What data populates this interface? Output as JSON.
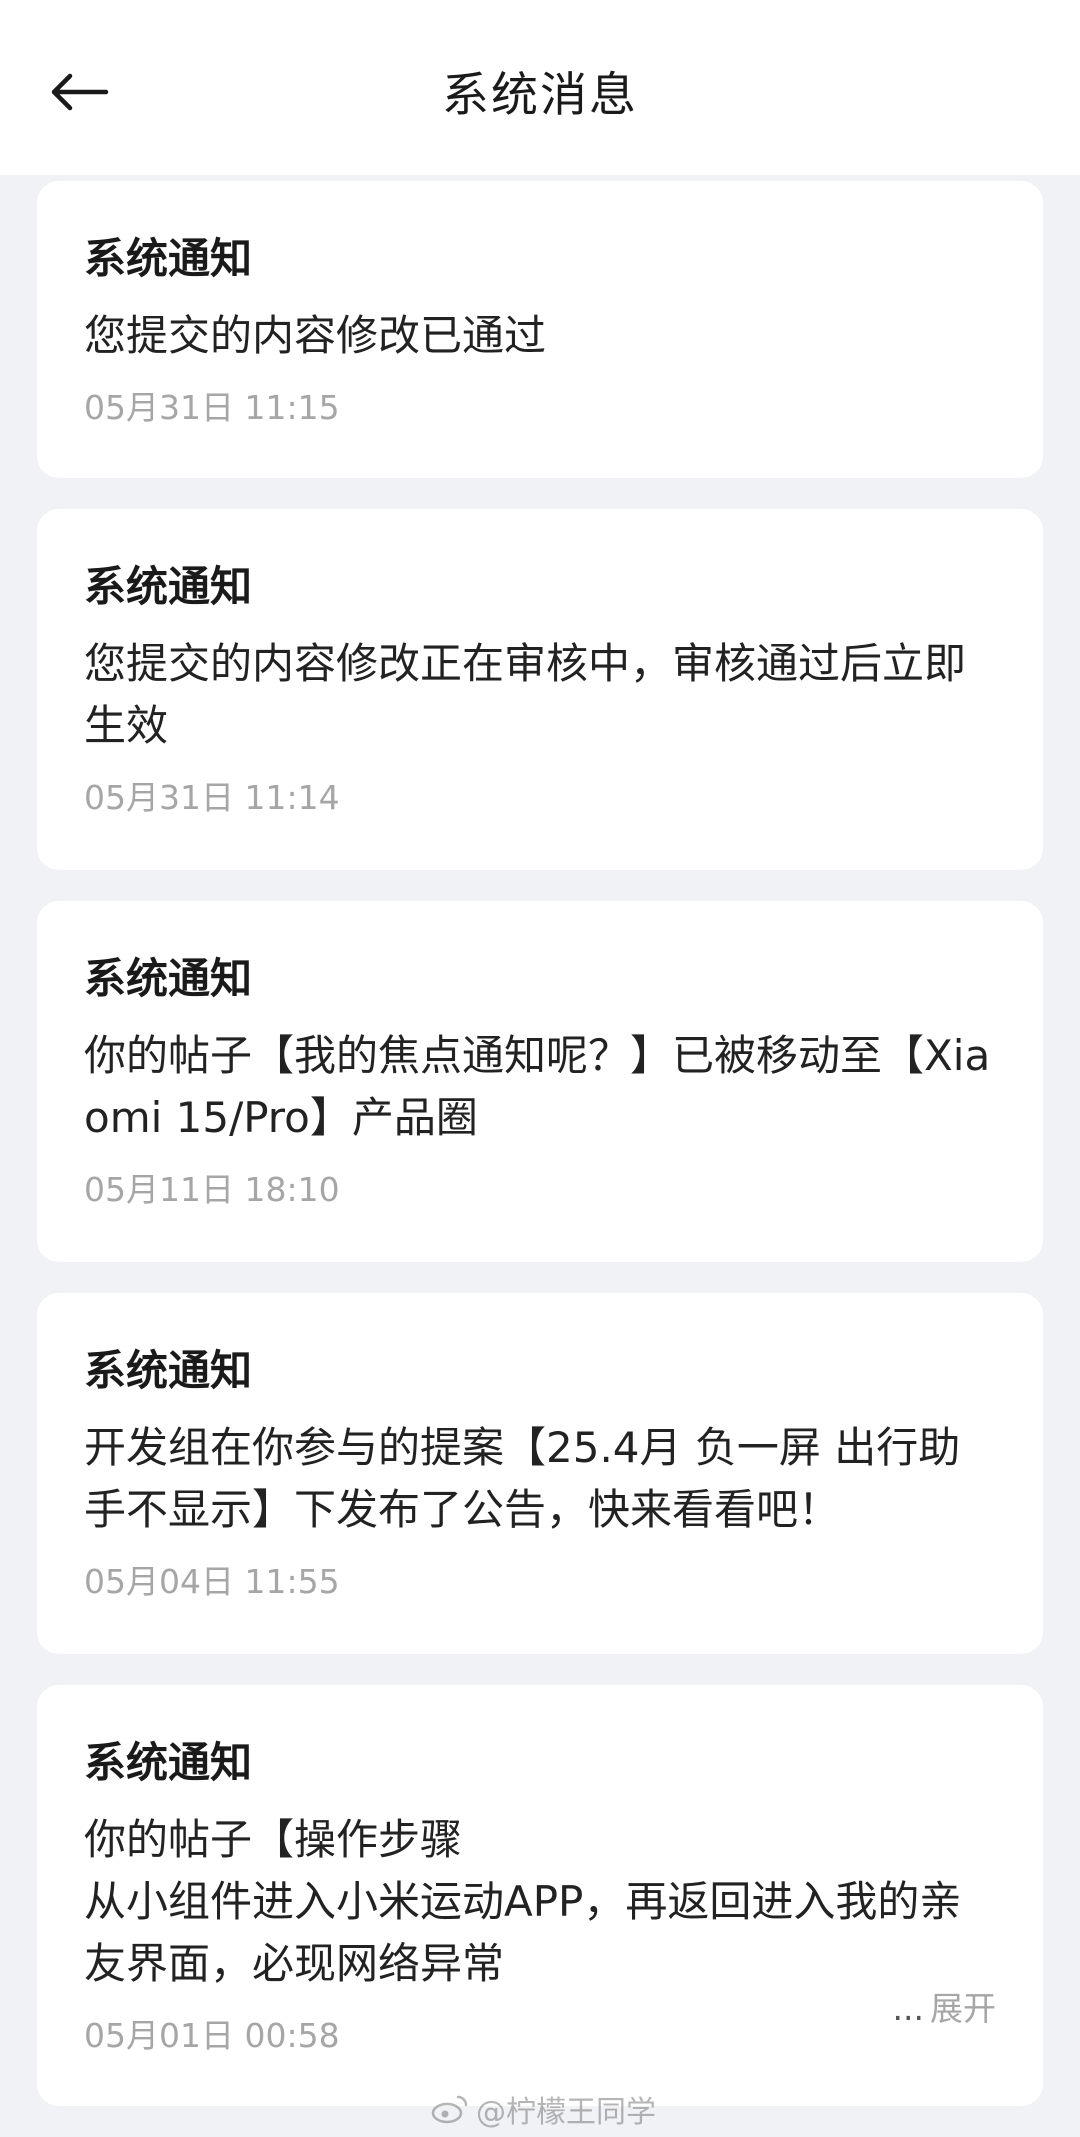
{
  "header": {
    "title": "系统消息",
    "back_icon": "arrow-left-icon"
  },
  "messages": [
    {
      "title": "系统通知",
      "body": "您提交的内容修改已通过",
      "time": "05月31日 11:15"
    },
    {
      "title": "系统通知",
      "body": "您提交的内容修改正在审核中，审核通过后立即生效",
      "time": "05月31日 11:14"
    },
    {
      "title": "系统通知",
      "body": "你的帖子【我的焦点通知呢？】已被移动至【Xiaomi 15/Pro】产品圈",
      "time": "05月11日 18:10"
    },
    {
      "title": "系统通知",
      "body": "开发组在你参与的提案【25.4月 负一屏 出行助手不显示】下发布了公告，快来看看吧！",
      "time": "05月04日 11:55"
    },
    {
      "title": "系统通知",
      "body": "你的帖子【操作步骤\n从小组件进入小米运动APP，再返回进入我的亲友界面，必现网络异常",
      "time": "05月01日 00:58",
      "expand_dots": "...",
      "expand_label": "展开"
    }
  ],
  "watermark": {
    "text": "@柠檬王同学",
    "icon": "weibo-logo-icon"
  },
  "colors": {
    "background": "#f1f2f5",
    "card": "#ffffff",
    "title_text": "#1a1a1a",
    "time_text": "#a6a6a6"
  }
}
